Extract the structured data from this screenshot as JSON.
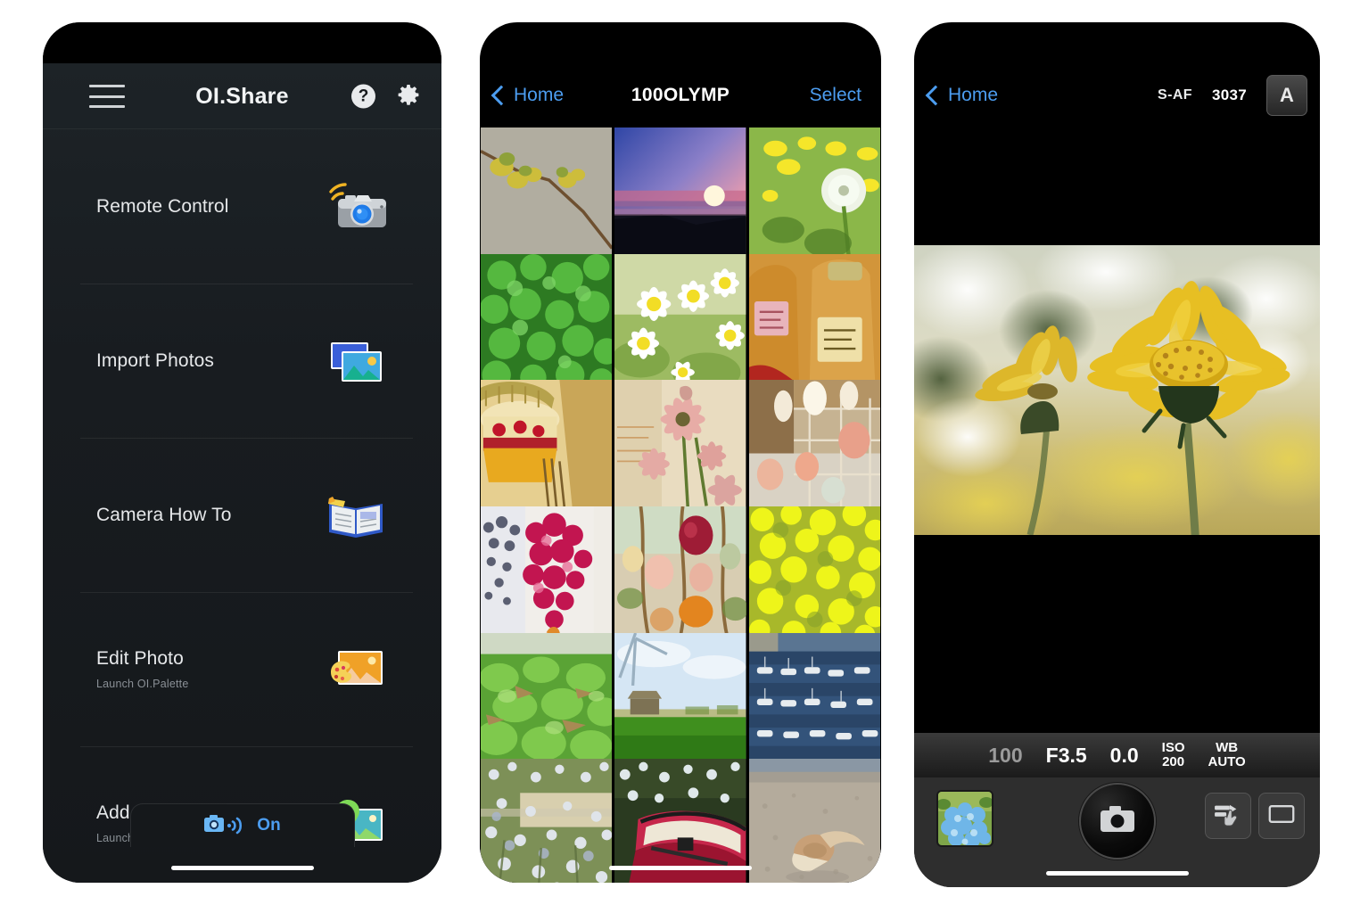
{
  "app": {
    "name": "OI.Share"
  },
  "screen_menu": {
    "header": {
      "title": "OI.Share",
      "menu_icon": "hamburger-icon",
      "help_icon": "help-icon",
      "help_glyph": "?",
      "settings_icon": "gear-icon"
    },
    "items": [
      {
        "label": "Remote Control",
        "sub": "",
        "icon": "camera-wifi-icon"
      },
      {
        "label": "Import Photos",
        "sub": "",
        "icon": "photos-stack-icon"
      },
      {
        "label": "Camera How To",
        "sub": "",
        "icon": "open-book-icon"
      },
      {
        "label": "Edit Photo",
        "sub": "Launch OI.Palette",
        "icon": "photo-palette-icon"
      },
      {
        "label": "Add Geotag",
        "sub": "Launch OI.Track",
        "icon": "photo-geotag-icon"
      }
    ],
    "footer": {
      "wifi_status_label": "On",
      "wifi_icon": "camera-wifi-status-icon",
      "accent_color": "#4c9df0"
    }
  },
  "screen_gallery": {
    "header": {
      "back_label": "Home",
      "back_icon": "chevron-left-icon",
      "title": "100OLYMP",
      "select_label": "Select"
    },
    "thumbnails": [
      {
        "alt": "vine on concrete wall",
        "palette": [
          "#b7b3a6",
          "#9a9588",
          "#c6c03f",
          "#7a5b31"
        ]
      },
      {
        "alt": "sunset over sea",
        "palette": [
          "#3d4c9e",
          "#8d7fc4",
          "#e8a0b4",
          "#11131f"
        ]
      },
      {
        "alt": "dandelion in yellow flowers",
        "palette": [
          "#8fbf45",
          "#f2e330",
          "#e9f0e0",
          "#5d8b2c"
        ]
      },
      {
        "alt": "green clover leaves",
        "palette": [
          "#4faf3b",
          "#2f7a26",
          "#76c95f",
          "#17480f"
        ]
      },
      {
        "alt": "white daisies",
        "palette": [
          "#c8d6a2",
          "#ffffff",
          "#f4dd2f",
          "#7ca23f"
        ]
      },
      {
        "alt": "bottles with labels",
        "palette": [
          "#d99c3a",
          "#c97f22",
          "#eddba6",
          "#8e4f13"
        ]
      },
      {
        "alt": "gold crown on cake",
        "palette": [
          "#e8cf8f",
          "#c5a04c",
          "#b0202b",
          "#f2e2b7"
        ]
      },
      {
        "alt": "pink carnation flowers",
        "palette": [
          "#e6d9c0",
          "#e7b0ae",
          "#9a8a5f",
          "#c98e8a"
        ]
      },
      {
        "alt": "hanging ornaments",
        "palette": [
          "#c9b492",
          "#efe5d6",
          "#e59b84",
          "#8b7150"
        ]
      },
      {
        "alt": "red beaded decoration",
        "palette": [
          "#f0eeea",
          "#c51650",
          "#dfe3ea",
          "#8a1338"
        ]
      },
      {
        "alt": "shells and ornaments",
        "palette": [
          "#d9cdb4",
          "#a01b32",
          "#e8b993",
          "#e3851f"
        ]
      },
      {
        "alt": "yellow rapeseed field",
        "palette": [
          "#e7ef17",
          "#c4d41a",
          "#9ab22a",
          "#f5f86a"
        ]
      },
      {
        "alt": "cabbage field",
        "palette": [
          "#7fc14b",
          "#4f9130",
          "#b7a580",
          "#d8e8cf"
        ]
      },
      {
        "alt": "windmill on green field",
        "palette": [
          "#cfe2f2",
          "#eaf2f8",
          "#3f8f1e",
          "#2b6b12"
        ]
      },
      {
        "alt": "marina with boats",
        "palette": [
          "#2e4c70",
          "#6e88a4",
          "#e8ecef",
          "#16283d"
        ]
      },
      {
        "alt": "white wildflowers",
        "palette": [
          "#8fa06a",
          "#e3e6ea",
          "#b7c2cf",
          "#5f7140"
        ]
      },
      {
        "alt": "red boat among flowers",
        "palette": [
          "#2a3a20",
          "#c6274b",
          "#eae4d4",
          "#9bb06a"
        ]
      },
      {
        "alt": "seashell on sandy beach",
        "palette": [
          "#b9b1a4",
          "#8c97a3",
          "#e0d4be",
          "#6f675c"
        ]
      }
    ]
  },
  "screen_camera": {
    "header": {
      "back_label": "Home",
      "back_icon": "chevron-left-icon",
      "af_mode": "S-AF",
      "shots_remaining": "3037",
      "shoot_mode": "A"
    },
    "live_view": {
      "alt": "two yellow daisy flowers close-up"
    },
    "exif": {
      "shutter_speed": "100",
      "aperture": "F3.5",
      "exposure_comp": "0.0",
      "iso_label": "ISO",
      "iso_value": "200",
      "wb_label": "WB",
      "wb_value": "AUTO"
    },
    "controls": {
      "thumbnail_icon": "last-photo-thumbnail",
      "thumbnail_alt": "blue hydrangea flowers",
      "shutter_icon": "camera-shutter-icon",
      "touch_shutter_icon": "touch-shutter-icon",
      "aspect_icon": "frame-aspect-icon"
    }
  }
}
